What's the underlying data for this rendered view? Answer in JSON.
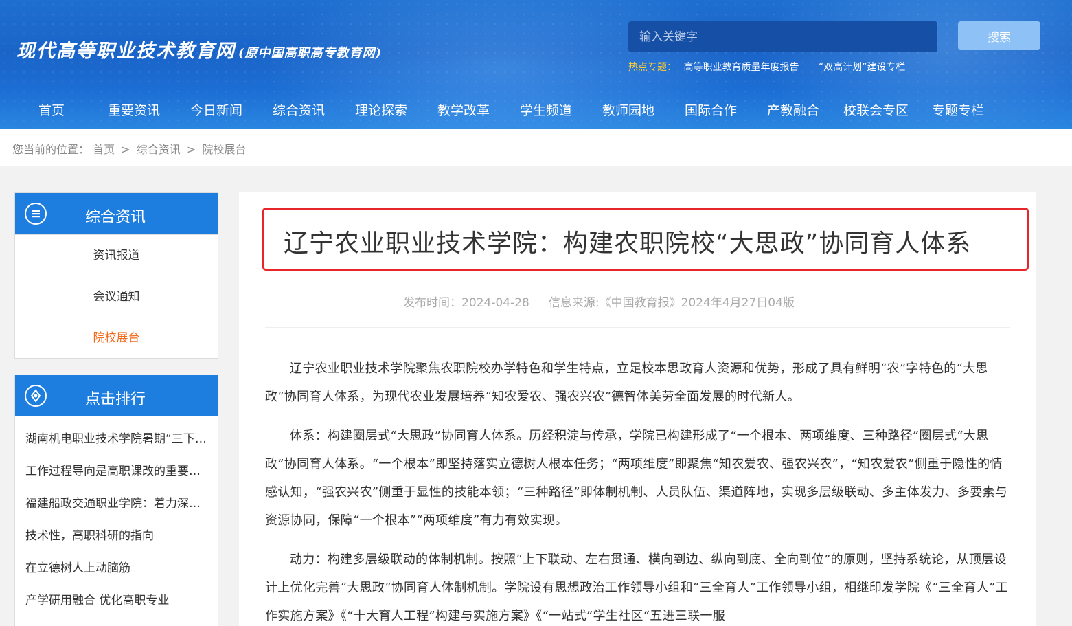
{
  "header": {
    "logo": "现代高等职业技术教育网",
    "logo_sub": "(原中国高职高专教育网)",
    "search_placeholder": "输入关键字",
    "search_button": "搜索",
    "hot_label": "热点专题：",
    "hot_links": [
      "高等职业教育质量年度报告",
      "“双高计划”建设专栏"
    ]
  },
  "nav": [
    "首页",
    "重要资讯",
    "今日新闻",
    "综合资讯",
    "理论探索",
    "教学改革",
    "学生频道",
    "教师园地",
    "国际合作",
    "产教融合",
    "校联会专区",
    "专题专栏"
  ],
  "breadcrumb": {
    "prefix": "您当前的位置：",
    "items": [
      "首页",
      "综合资讯",
      "院校展台"
    ],
    "separator": ">"
  },
  "sidebar": {
    "category_title": "综合资讯",
    "menu": [
      "资讯报道",
      "会议通知",
      "院校展台"
    ],
    "active_index": 2,
    "rank_title": "点击排行",
    "rank": [
      "湖南机电职业技术学院暑期“三下乡”",
      "工作过程导向是高职课改的重要方向",
      "福建船政交通职业学院：着力深化改革",
      "技术性，高职科研的指向",
      "在立德树人上动脑筋",
      "产学研用融合 优化高职专业"
    ]
  },
  "article": {
    "title": "辽宁农业职业技术学院：构建农职院校“大思政”协同育人体系",
    "publish_label": "发布时间：",
    "publish_date": "2024-04-28",
    "source_label": "信息来源:",
    "source": "《中国教育报》2024年4月27日04版",
    "paragraphs": [
      "辽宁农业职业技术学院聚焦农职院校办学特色和学生特点，立足校本思政育人资源和优势，形成了具有鲜明“农”字特色的“大思政”协同育人体系，为现代农业发展培养“知农爱农、强农兴农”德智体美劳全面发展的时代新人。",
      "体系：构建圈层式“大思政”协同育人体系。历经积淀与传承，学院已构建形成了“一个根本、两项维度、三种路径”圈层式“大思政”协同育人体系。“一个根本”即坚持落实立德树人根本任务；“两项维度”即聚焦“知农爱农、强农兴农”，“知农爱农”侧重于隐性的情感认知，“强农兴农”侧重于显性的技能本领；“三种路径”即体制机制、人员队伍、渠道阵地，实现多层级联动、多主体发力、多要素与资源协同，保障“一个根本”“两项维度”有力有效实现。",
      "动力：构建多层级联动的体制机制。按照“上下联动、左右贯通、横向到边、纵向到底、全向到位”的原则，坚持系统论，从顶层设计上优化完善“大思政”协同育人体制机制。学院设有思想政治工作领导小组和“三全育人”工作领导小组，相继印发学院《“三全育人”工作实施方案》《“十大育人工程”构建与实施方案》《“一站式”学生社区“五进三联一服"
    ]
  },
  "colors": {
    "header_blue": "#1a64c8",
    "sidebar_blue": "#1d7ee0",
    "active_orange": "#f26b1d",
    "highlight_red": "#e8262a",
    "hot_yellow": "#ffcc33"
  }
}
